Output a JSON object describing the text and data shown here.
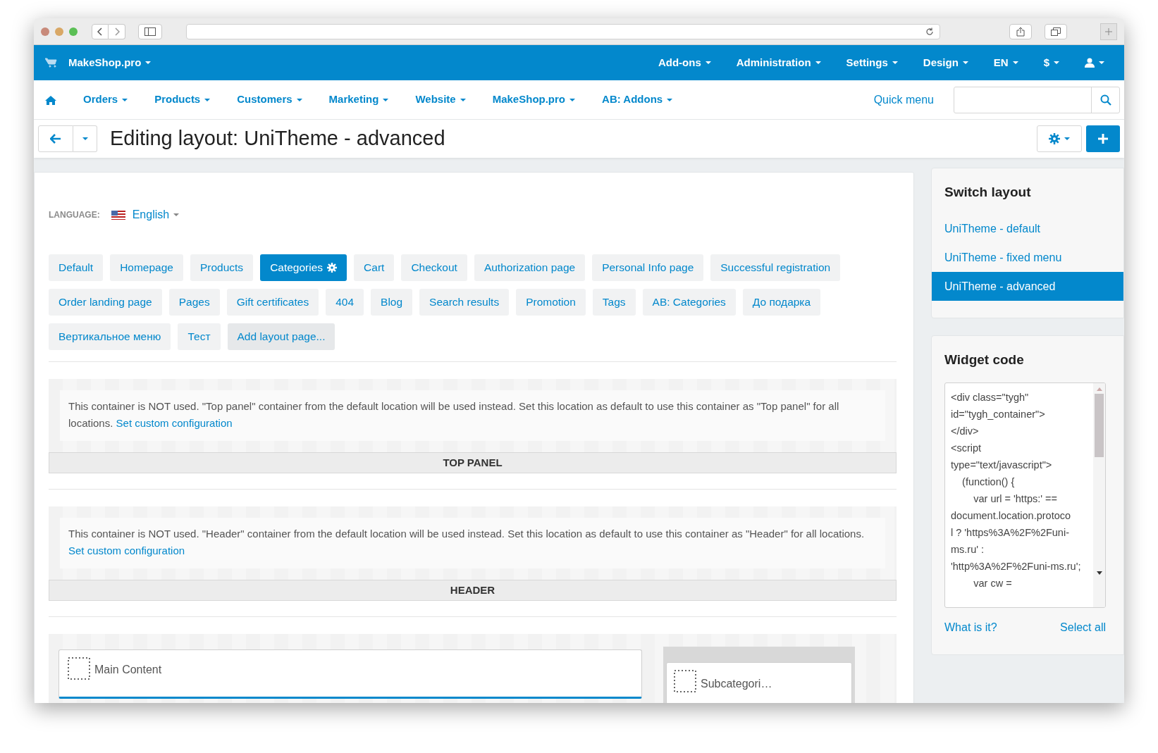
{
  "top_bar": {
    "brand": "MakeShop.pro",
    "menus": [
      "Add-ons",
      "Administration",
      "Settings",
      "Design",
      "EN",
      "$"
    ]
  },
  "nav": {
    "items": [
      "Orders",
      "Products",
      "Customers",
      "Marketing",
      "Website",
      "MakeShop.pro",
      "AB: Addons"
    ],
    "quick_menu": "Quick menu"
  },
  "page_title": "Editing layout: UniTheme - advanced",
  "language": {
    "label": "LANGUAGE:",
    "value": "English"
  },
  "layout_tabs": [
    {
      "label": "Default",
      "kind": "layout",
      "selected": false
    },
    {
      "label": "Homepage",
      "kind": "layout",
      "selected": false
    },
    {
      "label": "Products",
      "kind": "layout",
      "selected": false
    },
    {
      "label": "Categories",
      "kind": "layout",
      "selected": true
    },
    {
      "label": "Cart",
      "kind": "layout",
      "selected": false
    },
    {
      "label": "Checkout",
      "kind": "layout",
      "selected": false
    },
    {
      "label": "Authorization page",
      "kind": "layout",
      "selected": false
    },
    {
      "label": "Personal Info page",
      "kind": "layout",
      "selected": false
    },
    {
      "label": "Successful registration",
      "kind": "layout",
      "selected": false
    },
    {
      "label": "Order landing page",
      "kind": "layout",
      "selected": false
    },
    {
      "label": "Pages",
      "kind": "layout",
      "selected": false
    },
    {
      "label": "Gift certificates",
      "kind": "layout",
      "selected": false
    },
    {
      "label": "404",
      "kind": "layout",
      "selected": false
    },
    {
      "label": "Blog",
      "kind": "layout",
      "selected": false
    },
    {
      "label": "Search results",
      "kind": "layout",
      "selected": false
    },
    {
      "label": "Promotion",
      "kind": "layout",
      "selected": false
    },
    {
      "label": "Tags",
      "kind": "layout",
      "selected": false
    },
    {
      "label": "AB: Categories",
      "kind": "layout",
      "selected": false
    },
    {
      "label": "До подарка",
      "kind": "layout",
      "selected": false
    },
    {
      "label": "Вертикальное меню",
      "kind": "layout",
      "selected": false
    },
    {
      "label": "Тест",
      "kind": "layout",
      "selected": false
    },
    {
      "label": "Add layout page...",
      "kind": "add",
      "selected": false
    }
  ],
  "containers": [
    {
      "notice": "This container is NOT used. \"Top panel\" container from the default location will be used instead. Set this location as default to use this container as \"Top panel\" for all locations.",
      "link": "Set custom configuration",
      "title": "TOP PANEL"
    },
    {
      "notice": "This container is NOT used. \"Header\" container from the default location will be used instead. Set this location as default to use this container as \"Header\" for all locations.",
      "link": "Set custom configuration",
      "title": "HEADER"
    }
  ],
  "grids": [
    "Main Content",
    "Subcategori…"
  ],
  "switch_layout": {
    "title": "Switch layout",
    "items": [
      {
        "label": "UniTheme - default",
        "selected": false
      },
      {
        "label": "UniTheme - fixed menu",
        "selected": false
      },
      {
        "label": "UniTheme - advanced",
        "selected": true
      }
    ]
  },
  "widget_code": {
    "title": "Widget code",
    "lines": [
      "<div class=\"tygh\"",
      "id=\"tygh_container\">",
      "</div>",
      "<script",
      "type=\"text/javascript\">",
      "    (function() {",
      "        var url = 'https:' ==",
      "document.location.protoco",
      "l ? 'https%3A%2F%2Funi-",
      "ms.ru' :",
      "'http%3A%2F%2Funi-ms.ru';",
      "        var cw ="
    ],
    "help_link": "What is it?",
    "select_link": "Select all"
  }
}
